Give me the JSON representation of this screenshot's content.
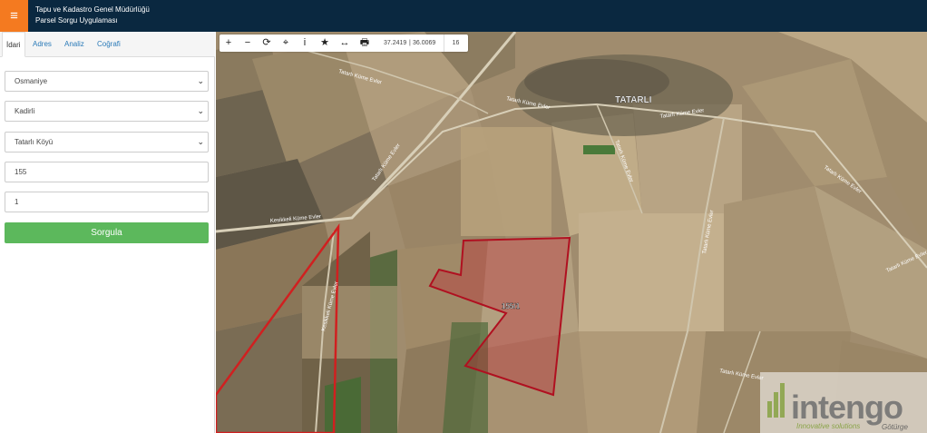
{
  "header": {
    "menu_icon": "≡",
    "title_line1": "Tapu ve Kadastro Genel Müdürlüğü",
    "title_line2": "Parsel Sorgu Uygulaması"
  },
  "tabs": [
    "İdari",
    "Adres",
    "Analiz",
    "Coğrafi"
  ],
  "form": {
    "il": "Osmaniye",
    "ilce": "Kadirli",
    "mahalle": "Tatarlı Köyü",
    "ada": "155",
    "parsel": "1",
    "submit_label": "Sorgula"
  },
  "toolbar": {
    "zoom_in": "+",
    "zoom_out": "−",
    "refresh": "⟳",
    "locate": "⌖",
    "info": "i",
    "favorite": "★",
    "measure": "↔",
    "print": "🖶",
    "lat": "37.2419",
    "lon": "36.0069",
    "zoom_level": "16"
  },
  "map": {
    "village_label": "TATARLI",
    "parcel_label": "155/1",
    "roads": {
      "r1": "Tatarlı Küme Evler",
      "r2": "Tatarlı Küme Evler",
      "r3": "Tatarlı Küme Evler",
      "r4": "Tatarlı Küme Evler",
      "r5": "Kesikkeli Küme Evler",
      "r6": "Tatarlı Küme Evler",
      "r7": "Kesikkeli Küme Evler",
      "r8": "Tatarlı Küme Evler",
      "r9": "Tatarlı Küme Evler",
      "r10": "Tatarlı Küme Evler",
      "r11": "Tatarlı Küme Evler"
    },
    "parcel_color": "#b01020"
  },
  "watermark": {
    "brand": "intengo",
    "tagline": "Innovative solutions",
    "tagline2": "Götürge"
  }
}
